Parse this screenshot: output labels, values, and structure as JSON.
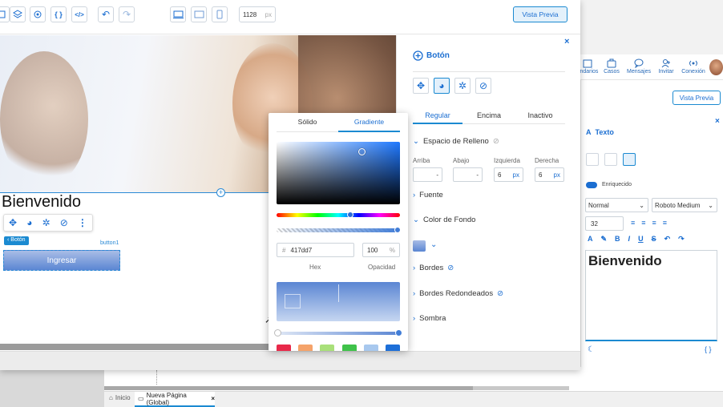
{
  "toolbar": {
    "width_value": "1128",
    "width_unit": "px",
    "preview_label": "Vista Previa"
  },
  "canvas": {
    "heading": "Bienvenido",
    "button_tag": "Botón",
    "button_id": "button1",
    "button_label": "Ingresar"
  },
  "props": {
    "title": "Botón",
    "state_tabs": [
      "Regular",
      "Encima",
      "Inactivo"
    ],
    "padding_title": "Espacio de Relleno",
    "padding_fields": [
      {
        "label": "Arriba",
        "value": "-",
        "unit": ""
      },
      {
        "label": "Abajo",
        "value": "-",
        "unit": ""
      },
      {
        "label": "Izquierda",
        "value": "6",
        "unit": "px"
      },
      {
        "label": "Derecha",
        "value": "6",
        "unit": "px"
      }
    ],
    "font": "Fuente",
    "bg": "Color de Fondo",
    "borders": "Bordes",
    "rounded": "Bordes Redondeados",
    "shadow": "Sombra"
  },
  "picker": {
    "tabs": [
      "Sólido",
      "Gradiente"
    ],
    "hex_prefix": "#",
    "hex_value": "417dd7",
    "opacity_value": "100",
    "opacity_unit": "%",
    "hex_label": "Hex",
    "opacity_label": "Opacidad",
    "swatches": [
      "#e8294a",
      "#f5a36a",
      "#a9e07a",
      "#3fc24a",
      "#a8c8ee",
      "#1d6fd8"
    ]
  },
  "back": {
    "nav": [
      "endarios",
      "Casos",
      "Mensajes",
      "Invitar",
      "Conexión"
    ],
    "preview_label": "Vista Previa",
    "panel_title": "Texto",
    "enriched_label": "Enriquecido",
    "style_select": "Normal",
    "font_select": "Roboto Medium",
    "size_value": "32",
    "editor_text": "Bienvenido",
    "tabs": [
      {
        "label": "Inicio"
      },
      {
        "label": "Nueva Página (Global)"
      }
    ]
  },
  "colors": {
    "accent": "#1b8ad1",
    "button_top": "#a9bde6",
    "button_bottom": "#5b86d3",
    "picker_hue": "#1e78ff"
  }
}
